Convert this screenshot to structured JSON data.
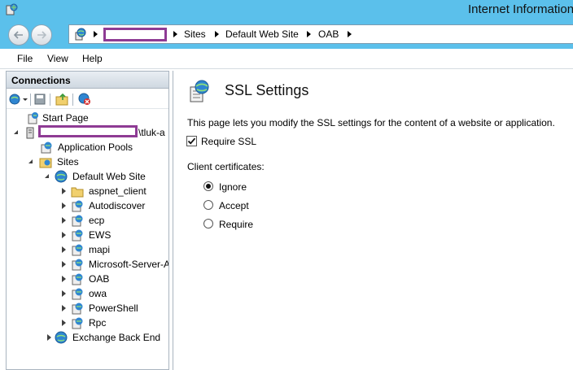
{
  "window": {
    "title": "Internet Information",
    "titlebar_color": "#5bc0eb",
    "app_icon": "iis-manager-icon"
  },
  "address_bar": {
    "back_icon": "back-arrow-icon",
    "forward_icon": "forward-arrow-icon",
    "root_icon": "globe-icon",
    "crumbs": [
      "Sites",
      "Default Web Site",
      "OAB"
    ]
  },
  "menu": {
    "items": [
      "File",
      "View",
      "Help"
    ]
  },
  "connections": {
    "title": "Connections",
    "toolbar_icons": [
      "connect-icon",
      "save-icon",
      "up-folder-icon",
      "disconnect-icon"
    ],
    "tree": {
      "start_page": "Start Page",
      "server_suffix": "\\tluk-a",
      "app_pools": "Application Pools",
      "sites": "Sites",
      "default_site": "Default Web Site",
      "children": [
        "aspnet_client",
        "Autodiscover",
        "ecp",
        "EWS",
        "mapi",
        "Microsoft-Server-A",
        "OAB",
        "owa",
        "PowerShell",
        "Rpc"
      ],
      "backend": "Exchange Back End"
    }
  },
  "main": {
    "title": "SSL Settings",
    "description": "This page lets you modify the SSL settings for the content of a website or application.",
    "require_ssl_label": "Require SSL",
    "require_ssl_checked": true,
    "client_cert_label": "Client certificates:",
    "options": [
      "Ignore",
      "Accept",
      "Require"
    ],
    "selected_option": "Ignore"
  },
  "colors": {
    "redaction": "#8e3b94",
    "pane_border": "#a9b4bf"
  }
}
